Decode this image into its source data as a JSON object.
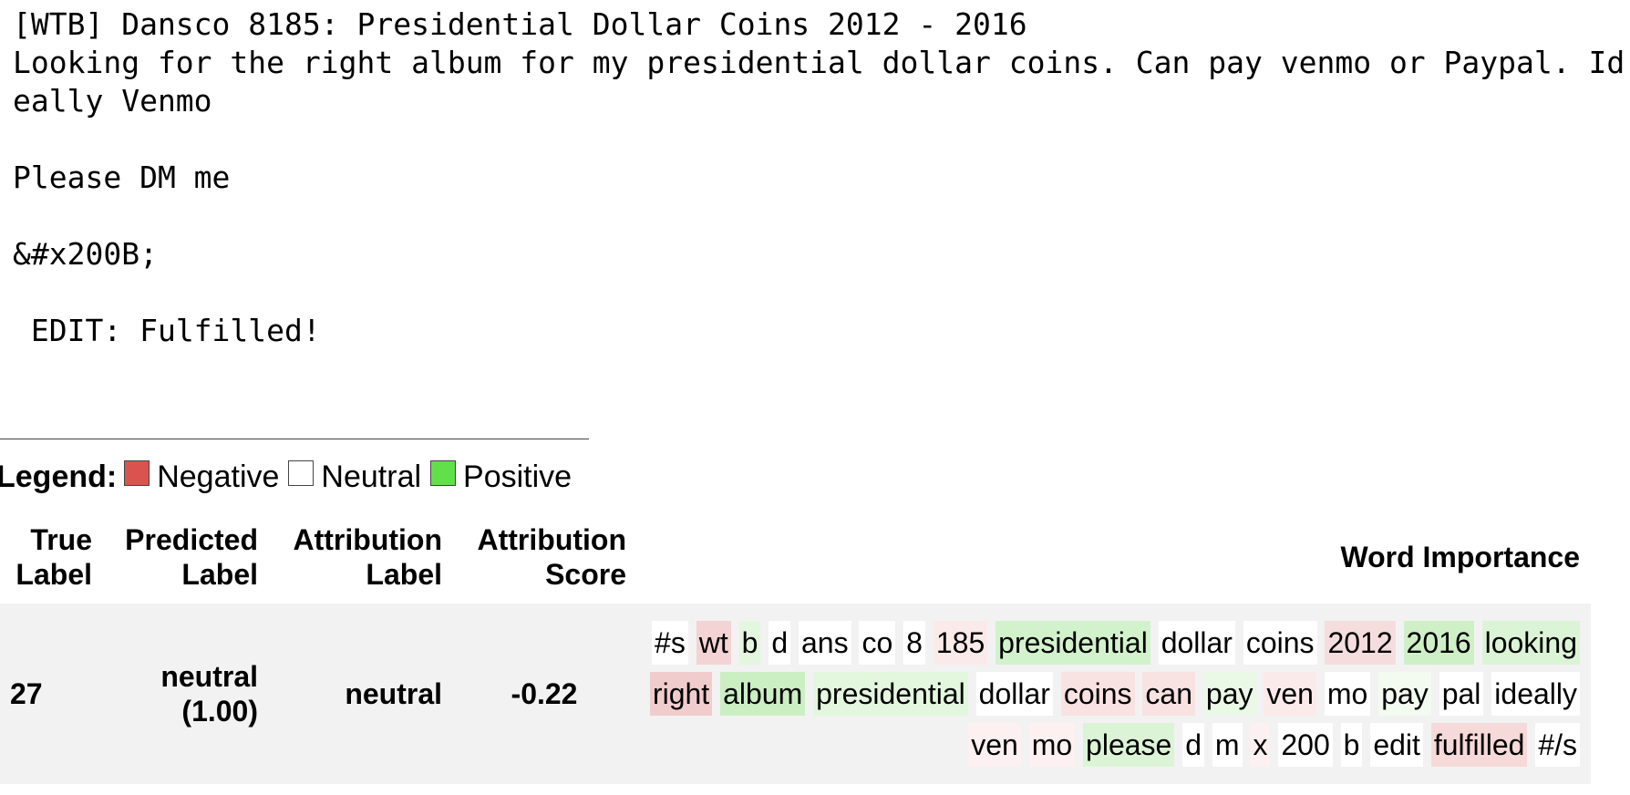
{
  "post": {
    "title": "[WTB] Dansco 8185: Presidential Dollar Coins 2012 - 2016",
    "body": "Looking for the right album for my presidential dollar coins. Can pay venmo or Paypal. Ideally Venmo\n\nPlease DM me\n\n&#x200B;\n\n EDIT: Fulfilled!"
  },
  "legend": {
    "title": "Legend:",
    "items": [
      {
        "label": "Negative",
        "color": "#d9534f"
      },
      {
        "label": "Neutral",
        "color": "#ffffff"
      },
      {
        "label": "Positive",
        "color": "#62e04a"
      }
    ]
  },
  "table": {
    "headers": {
      "true_label": "True Label",
      "predicted_label": "Predicted Label",
      "attribution_label": "Attribution Label",
      "attribution_score": "Attribution Score",
      "word_importance": "Word Importance"
    },
    "row": {
      "true_label": "27",
      "predicted_label": "neutral (1.00)",
      "attribution_label": "neutral",
      "attribution_score": "-0.22"
    },
    "tokens": [
      {
        "text": "#s",
        "color": "#ffffff"
      },
      {
        "text": "wt",
        "color": "#f3d3d3"
      },
      {
        "text": "b",
        "color": "#e3f7df"
      },
      {
        "text": "d",
        "color": "#ffffff"
      },
      {
        "text": "ans",
        "color": "#ffffff"
      },
      {
        "text": "co",
        "color": "#ffffff"
      },
      {
        "text": "8",
        "color": "#ffffff"
      },
      {
        "text": "185",
        "color": "#fbeaea"
      },
      {
        "text": "presidential",
        "color": "#d2f2cb"
      },
      {
        "text": "dollar",
        "color": "#ffffff"
      },
      {
        "text": "coins",
        "color": "#ffffff"
      },
      {
        "text": "2012",
        "color": "#f6dddd"
      },
      {
        "text": "2016",
        "color": "#cff0c7"
      },
      {
        "text": "looking",
        "color": "#dcf4d6"
      },
      {
        "text": "right",
        "color": "#f1cccc"
      },
      {
        "text": "album",
        "color": "#cbefc3"
      },
      {
        "text": "presidential",
        "color": "#e3f7df"
      },
      {
        "text": "dollar",
        "color": "#ffffff"
      },
      {
        "text": "coins",
        "color": "#f8e2e2"
      },
      {
        "text": "can",
        "color": "#f8e2e2"
      },
      {
        "text": "pay",
        "color": "#eaf8e6"
      },
      {
        "text": "ven",
        "color": "#fbeaea"
      },
      {
        "text": "mo",
        "color": "#ffffff"
      },
      {
        "text": "pay",
        "color": "#f3fbf1"
      },
      {
        "text": "pal",
        "color": "#ffffff"
      },
      {
        "text": "ideally",
        "color": "#ffffff"
      },
      {
        "text": "ven",
        "color": "#fcf0f0"
      },
      {
        "text": "mo",
        "color": "#fcf0f0"
      },
      {
        "text": "please",
        "color": "#dcf4d6"
      },
      {
        "text": "d",
        "color": "#ffffff"
      },
      {
        "text": "m",
        "color": "#ffffff"
      },
      {
        "text": "x",
        "color": "#fcf0f0"
      },
      {
        "text": "200",
        "color": "#ffffff"
      },
      {
        "text": "b",
        "color": "#ffffff"
      },
      {
        "text": "edit",
        "color": "#ffffff"
      },
      {
        "text": "fulfilled",
        "color": "#f6d9d9"
      },
      {
        "text": "#/s",
        "color": "#ffffff"
      }
    ]
  }
}
